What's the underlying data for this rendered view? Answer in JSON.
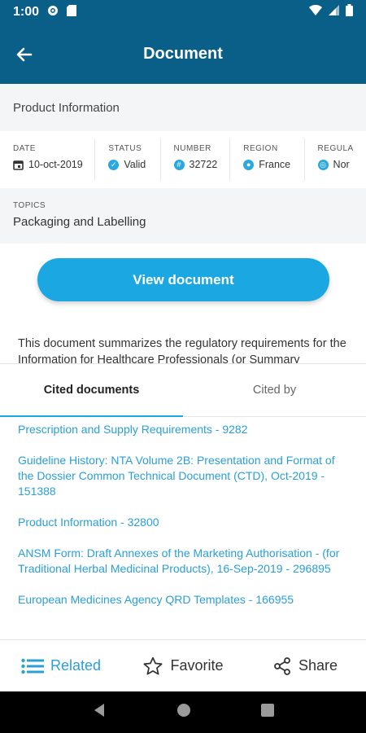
{
  "status_bar": {
    "time": "1:00"
  },
  "header": {
    "title": "Document"
  },
  "product_info": {
    "label": "Product Information"
  },
  "meta": {
    "date": {
      "label": "DATE",
      "value": "10-oct-2019"
    },
    "status": {
      "label": "STATUS",
      "value": "Valid"
    },
    "number": {
      "label": "NUMBER",
      "value": "32722"
    },
    "region": {
      "label": "REGION",
      "value": "France"
    },
    "regulatory": {
      "label": "REGULA",
      "value": "Nor"
    }
  },
  "topics": {
    "label": "TOPICS",
    "value": "Packaging and Labelling"
  },
  "view_button": {
    "label": "View document"
  },
  "description": {
    "text": "This document summarizes the regulatory requirements for the Information for Healthcare Professionals (or Summary"
  },
  "tabs": [
    {
      "label": "Cited documents"
    },
    {
      "label": "Cited by"
    }
  ],
  "cited_documents": [
    "Prescription and Supply Requirements - 9282",
    "Guideline History: NTA Volume 2B: Presentation and Format of the Dossier Common Technical Document (CTD), Oct-2019 - 151388",
    "Product Information - 32800",
    "ANSM Form: Draft Annexes of the Marketing Authorisation - (for Traditional Herbal Medicinal Products), 16-Sep-2019 - 296895",
    "European Medicines Agency QRD Templates - 166955"
  ],
  "bottom_nav": {
    "related": "Related",
    "favorite": "Favorite",
    "share": "Share"
  },
  "colors": {
    "header": "#0a5f89",
    "accent": "#1aa7e2",
    "link": "#2a9fd8"
  }
}
